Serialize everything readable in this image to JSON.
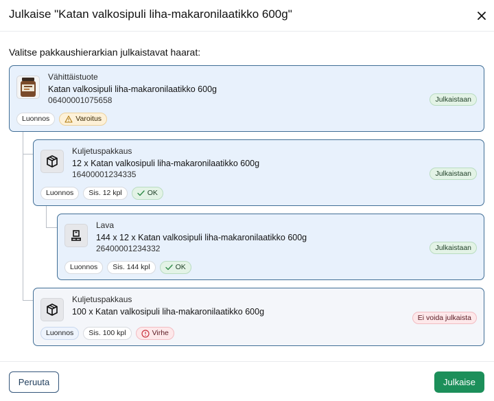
{
  "dialog": {
    "title": "Julkaise \"Katan valkosipuli liha-makaronilaatikko 600g\"",
    "instruction": "Valitse pakkaushierarkian julkaistavat haarat:"
  },
  "items": [
    {
      "type": "Vähittäistuote",
      "name": "Katan valkosipuli liha-makaronilaatikko 600g",
      "gtin": "06400001075658",
      "status": "Julkaistaan",
      "chips": {
        "draft": "Luonnos",
        "validation": "Varoitus"
      }
    },
    {
      "type": "Kuljetuspakkaus",
      "name": "12 x Katan valkosipuli liha-makaronilaatikko 600g",
      "gtin": "16400001234335",
      "status": "Julkaistaan",
      "chips": {
        "draft": "Luonnos",
        "contains": "Sis. 12 kpl",
        "validation": "OK"
      }
    },
    {
      "type": "Lava",
      "name": "144 x 12 x Katan valkosipuli liha-makaronilaatikko 600g",
      "gtin": "26400001234332",
      "status": "Julkaistaan",
      "chips": {
        "draft": "Luonnos",
        "contains": "Sis. 144 kpl",
        "validation": "OK"
      }
    },
    {
      "type": "Kuljetuspakkaus",
      "name": "100 x Katan valkosipuli liha-makaronilaatikko 600g",
      "status": "Ei voida julkaista",
      "chips": {
        "draft": "Luonnos",
        "contains": "Sis. 100 kpl",
        "validation": "Virhe"
      }
    }
  ],
  "footer": {
    "cancel": "Peruuta",
    "publish": "Julkaise"
  },
  "icons": [
    "close-icon",
    "product-image",
    "box-icon",
    "pallet-icon",
    "warning-icon",
    "check-icon",
    "error-icon"
  ],
  "colors": {
    "primary": "#1c8f5a",
    "card_border": "#3f6d95",
    "card_bg": "#e8f1fc"
  }
}
